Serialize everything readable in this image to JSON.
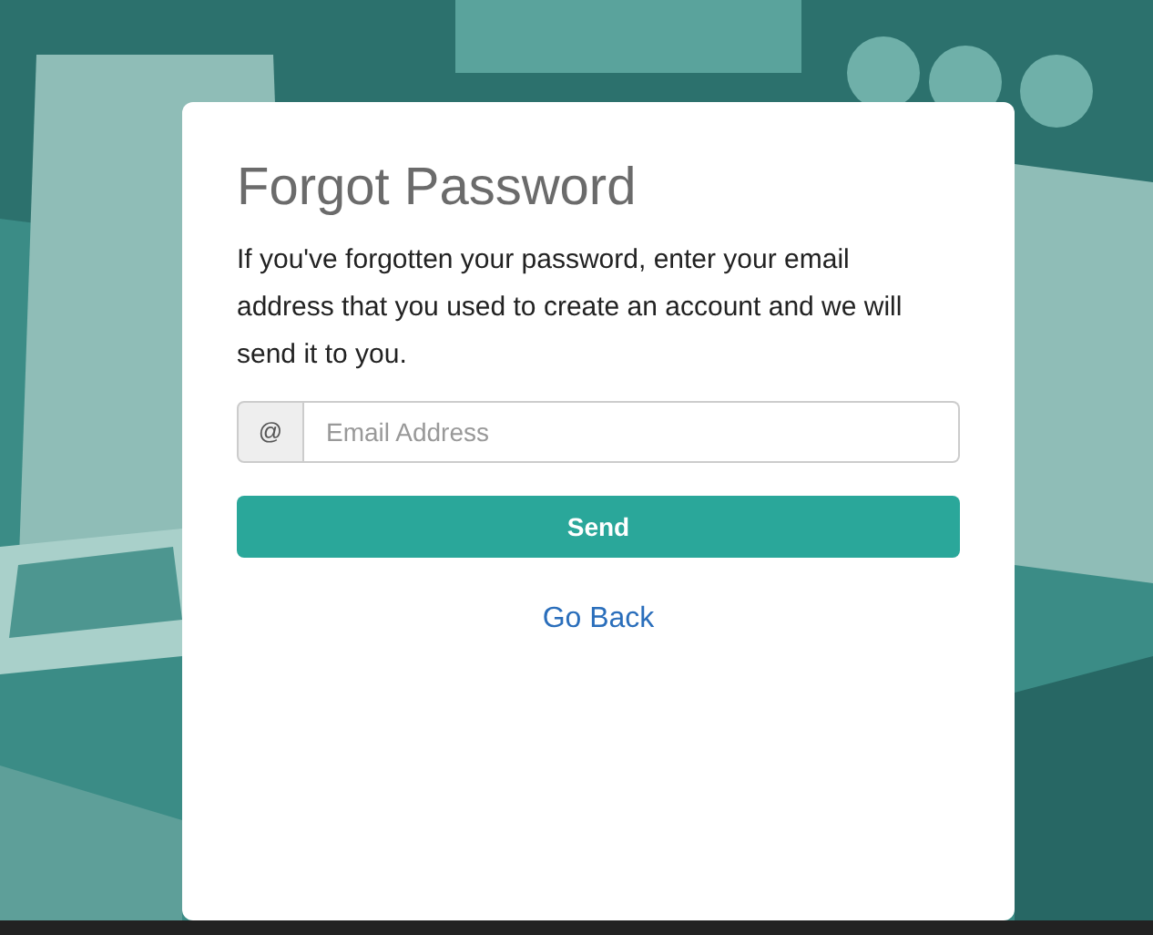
{
  "dialog": {
    "title": "Forgot Password",
    "message": "If you've forgotten your password, enter your email address that you used to create an account and we will send it to you.",
    "email_field": {
      "addon": "@",
      "placeholder": "Email Address"
    },
    "send_button": "Send",
    "back_link": "Go Back"
  }
}
